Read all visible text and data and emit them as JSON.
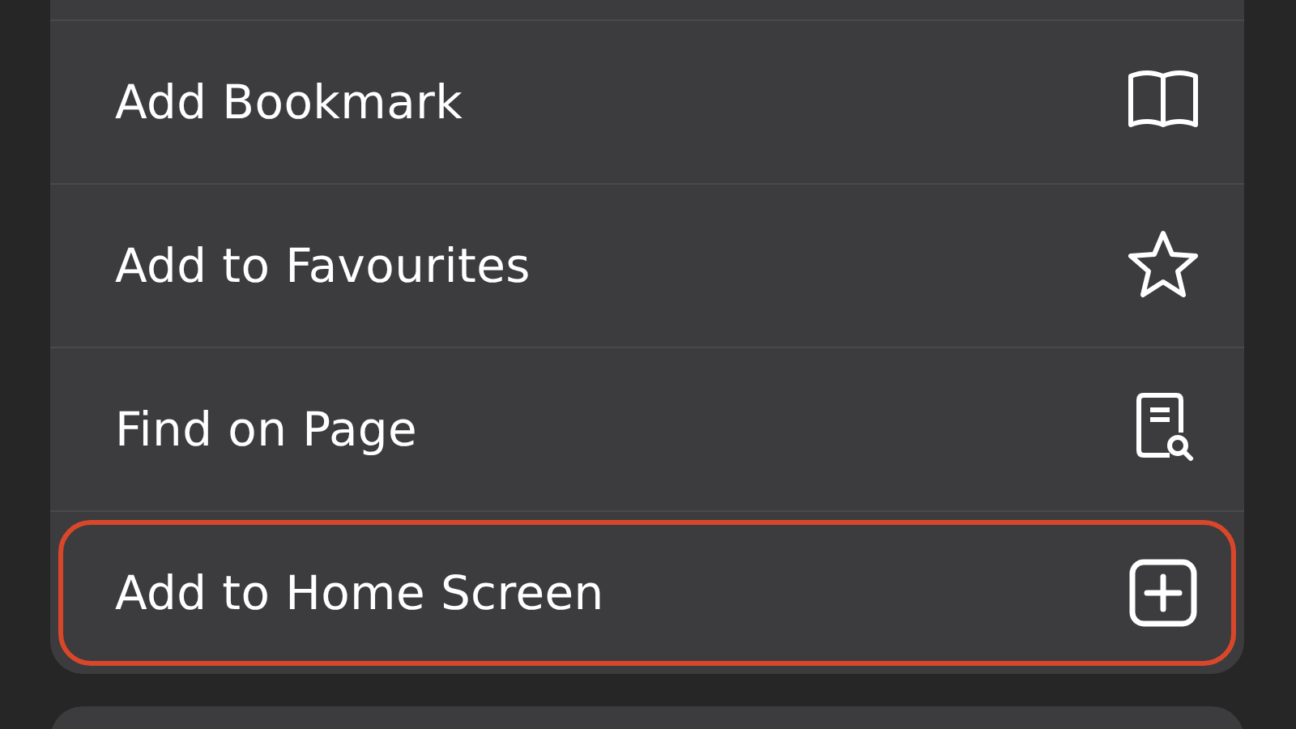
{
  "menu": {
    "items": [
      {
        "label": "Add Bookmark",
        "kind": "bookmark",
        "highlighted": false
      },
      {
        "label": "Add to Favourites",
        "kind": "favourite",
        "highlighted": false
      },
      {
        "label": "Find on Page",
        "kind": "find",
        "highlighted": false
      },
      {
        "label": "Add to Home Screen",
        "kind": "home-screen",
        "highlighted": true
      }
    ]
  }
}
